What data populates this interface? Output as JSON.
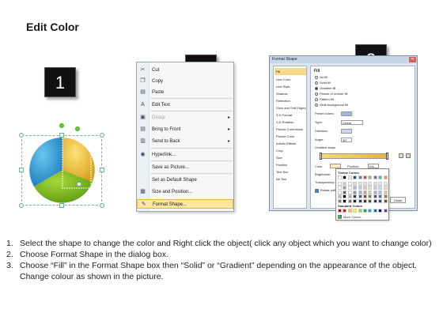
{
  "page_title": "Edit Color",
  "steps": [
    "1",
    "2",
    "3"
  ],
  "context_menu": {
    "items": [
      {
        "label": "Cut",
        "icon": "scissors-icon",
        "glyph": "✂"
      },
      {
        "label": "Copy",
        "icon": "copy-icon",
        "glyph": "❐"
      },
      {
        "label": "Paste",
        "icon": "paste-icon",
        "glyph": "📋"
      },
      {
        "label": "Edit Text",
        "icon": "edit-text-icon",
        "glyph": "A"
      },
      {
        "label": "Group",
        "icon": "group-icon",
        "glyph": "▣"
      },
      {
        "label": "Bring to Front",
        "icon": "bring-front-icon",
        "glyph": "▤"
      },
      {
        "label": "Send to Back",
        "icon": "send-back-icon",
        "glyph": "▥"
      },
      {
        "label": "Hyperlink...",
        "icon": "hyperlink-icon",
        "glyph": "◉"
      },
      {
        "label": "Save as Picture...",
        "icon": "",
        "glyph": ""
      },
      {
        "label": "Set as Default Shape",
        "icon": "",
        "glyph": ""
      },
      {
        "label": "Size and Position...",
        "icon": "size-position-icon",
        "glyph": "▦"
      },
      {
        "label": "Format Shape...",
        "icon": "format-shape-icon",
        "glyph": "✎"
      }
    ]
  },
  "format_dialog": {
    "title": "Format Shape",
    "sidebar": [
      "Fill",
      "Line Color",
      "Line Style",
      "Shadow",
      "Reflection",
      "Glow and Soft Edges",
      "3-D Format",
      "3-D Rotation",
      "Picture Corrections",
      "Picture Color",
      "Artistic Effects",
      "Crop",
      "Size",
      "Position",
      "Text Box",
      "Alt Text"
    ],
    "section": "Fill",
    "fill_options": [
      "No fill",
      "Solid fill",
      "Gradient fill",
      "Picture or texture fill",
      "Pattern fill",
      "Slide background fill"
    ],
    "labels": {
      "preset": "Preset colors:",
      "type": "Type:",
      "type_value": "Linear",
      "direction": "Direction:",
      "angle": "Angle:",
      "angle_value": "90°",
      "stops": "Gradient stops",
      "color": "Color",
      "position": "Position:",
      "position_value": "0%",
      "brightness": "Brightness:",
      "transparency": "Transparency:",
      "rotate": "Rotate with shape",
      "close": "Close"
    },
    "palette": {
      "theme_label": "Theme Colors",
      "standard_label": "Standard Colors",
      "more_label": "More Colors..."
    }
  },
  "instructions": [
    {
      "num": "1.",
      "text": "Select the shape to change the color and Right click the object( click any object which you want to change color)"
    },
    {
      "num": "2.",
      "text": "Choose Format Shape in the dialog box."
    },
    {
      "num": "3.",
      "text": "Choose “Fill” in the Format Shape box then “Solid” or “Gradient” depending on the appearance of the object. Change colour as shown in the picture."
    }
  ]
}
